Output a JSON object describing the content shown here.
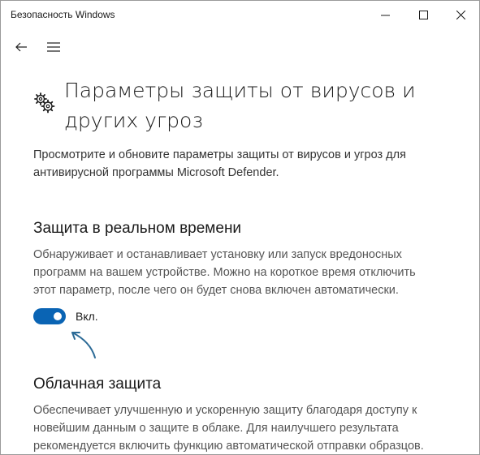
{
  "window": {
    "title": "Безопасность Windows"
  },
  "nav": {
    "back_icon": "back-arrow-icon",
    "menu_icon": "hamburger-icon"
  },
  "page": {
    "icon": "gear-icon",
    "title": "Параметры защиты от вирусов и других угроз",
    "intro": "Просмотрите и обновите параметры защиты от вирусов и угроз для антивирусной программы Microsoft Defender."
  },
  "realtime": {
    "title": "Защита в реальном времени",
    "description": "Обнаруживает и останавливает установку или запуск вредоносных программ на вашем устройстве. Можно на короткое время отключить этот параметр, после чего он будет снова включен автоматически.",
    "toggle_state": true,
    "toggle_label": "Вкл."
  },
  "cloud": {
    "title": "Облачная защита",
    "description": "Обеспечивает улучшенную и ускоренную защиту благодаря доступу к новейшим данным о защите в облаке. Для наилучшего результата рекомендуется включить функцию автоматической отправки образцов."
  },
  "colors": {
    "accent": "#0a64b4",
    "annotation_arrow": "#2b6a96"
  }
}
